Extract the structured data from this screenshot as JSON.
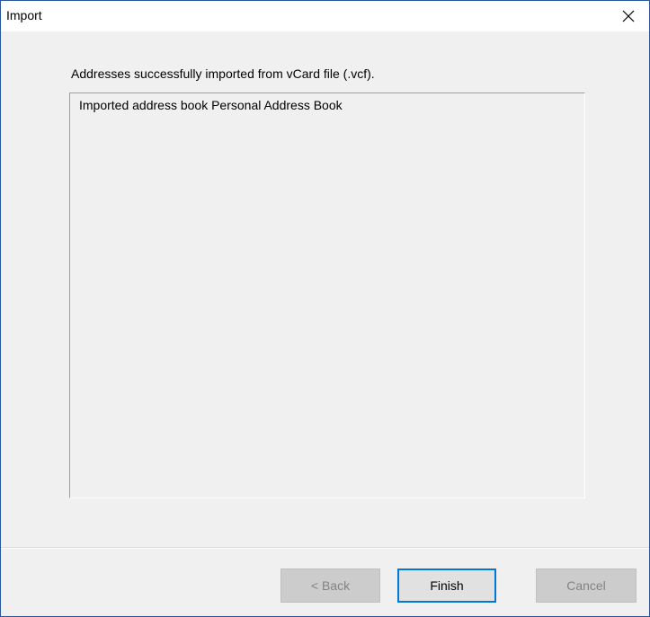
{
  "window": {
    "title": "Import",
    "close_icon": "close-icon"
  },
  "main": {
    "message": "Addresses successfully imported from vCard file (.vcf).",
    "log_lines": [
      "Imported address book Personal Address Book"
    ]
  },
  "footer": {
    "back_label": "< Back",
    "finish_label": "Finish",
    "cancel_label": "Cancel"
  },
  "colors": {
    "window_border": "#2b579a",
    "default_button_border": "#0078d7",
    "background": "#f0f0f0"
  }
}
